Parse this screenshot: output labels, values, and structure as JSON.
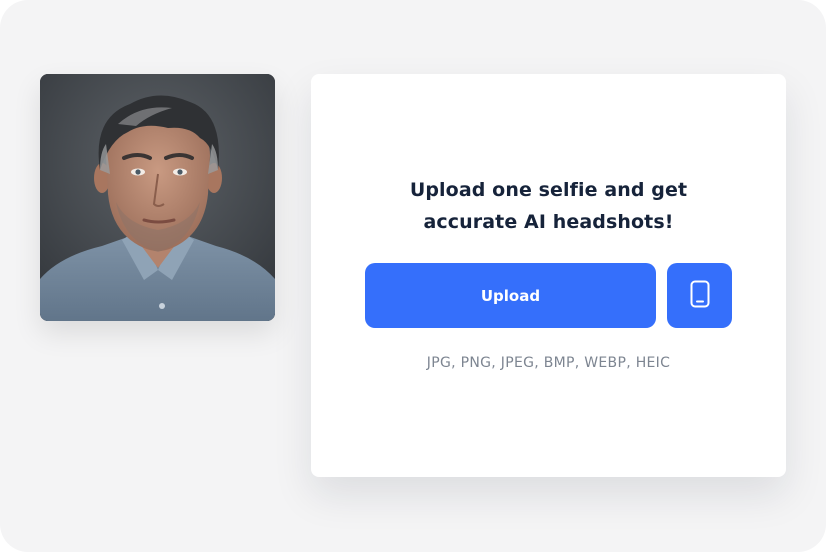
{
  "upload_card": {
    "headline_line1": "Upload one selfie and get",
    "headline_line2": "accurate AI headshots!",
    "upload_label": "Upload",
    "phone_icon": "smartphone-icon",
    "formats": "JPG, PNG, JPEG, BMP, WEBP, HEIC"
  },
  "photo": {
    "subject": "portrait of a grey-haired man in a light blue denim shirt"
  },
  "colors": {
    "accent": "#356ffb",
    "background": "#f4f4f5",
    "card": "#ffffff",
    "headline": "#16233a",
    "muted": "#7d8591"
  }
}
